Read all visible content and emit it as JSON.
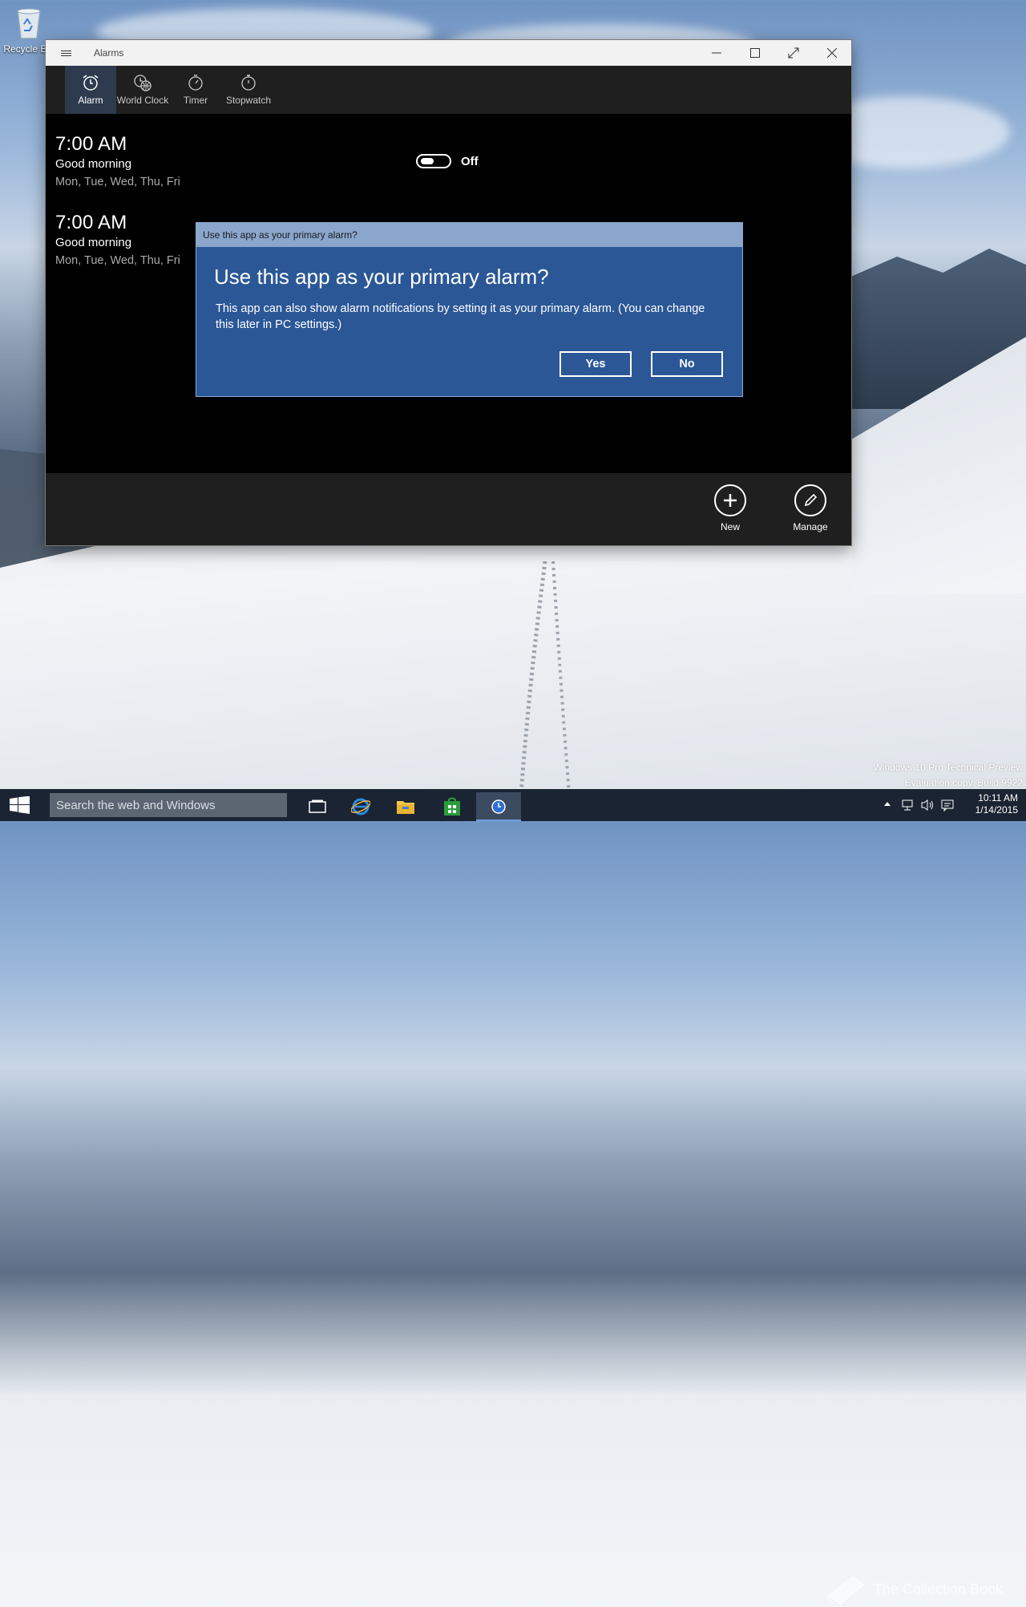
{
  "desktop": {
    "recycle_bin_label": "Recycle Bin",
    "watermark_line1": "Windows 10 Pro Technical Preview",
    "watermark_line2": "Evaluation copy. Build 9922",
    "logo_text": "The Collection Book"
  },
  "window": {
    "title": "Alarms",
    "nav": [
      {
        "label": "Alarm",
        "icon": "alarm-clock-icon",
        "active": true
      },
      {
        "label": "World Clock",
        "icon": "world-clock-icon",
        "active": false
      },
      {
        "label": "Timer",
        "icon": "timer-icon",
        "active": false
      },
      {
        "label": "Stopwatch",
        "icon": "stopwatch-icon",
        "active": false
      }
    ],
    "alarms": [
      {
        "time": "7:00 AM",
        "name": "Good morning",
        "days": "Mon, Tue, Wed, Thu, Fri",
        "toggle_label": "Off"
      },
      {
        "time": "7:00 AM",
        "name": "Good morning",
        "days": "Mon, Tue, Wed, Thu, Fri"
      }
    ],
    "appbar": {
      "new_label": "New",
      "manage_label": "Manage"
    }
  },
  "dialog": {
    "caption": "Use this app as your primary alarm?",
    "title": "Use this app as your primary alarm?",
    "body": "This app can also show alarm notifications by setting it as your primary alarm. (You can change this later in PC settings.)",
    "yes_label": "Yes",
    "no_label": "No"
  },
  "taskbar": {
    "search_placeholder": "Search the web and Windows",
    "time": "10:11 AM",
    "date": "1/14/2015"
  },
  "colors": {
    "dialog_bg": "#2b5797",
    "dialog_caption_bg": "#8aa6cc",
    "taskbar_bg": "#1a2433",
    "active_tab_bg": "#2e3b4e"
  }
}
